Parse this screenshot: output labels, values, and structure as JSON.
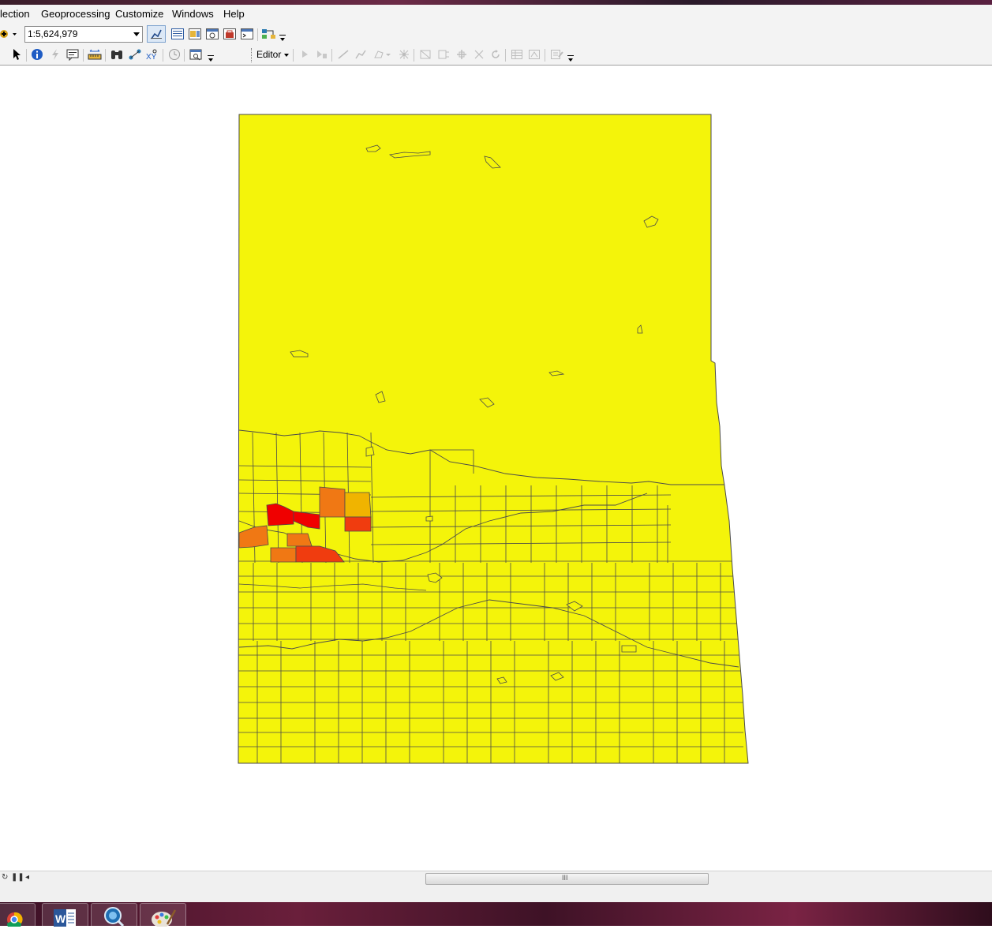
{
  "menu": {
    "items": [
      "lection",
      "Geoprocessing",
      "Customize",
      "Windows",
      "Help"
    ]
  },
  "toolbar": {
    "scale": "1:5,624,979",
    "editor_label": "Editor"
  },
  "map": {
    "fill_colors": {
      "base": "#f4f40a",
      "low_orange": "#f0b400",
      "orange": "#f07814",
      "red_orange": "#f03c0f",
      "red": "#f00000"
    },
    "outline_color": "#4a4a4a"
  },
  "statusbar": {
    "grip": "III"
  },
  "taskbar": {
    "apps": [
      "chrome-icon",
      "word-icon",
      "search-icon",
      "paint-icon"
    ]
  }
}
